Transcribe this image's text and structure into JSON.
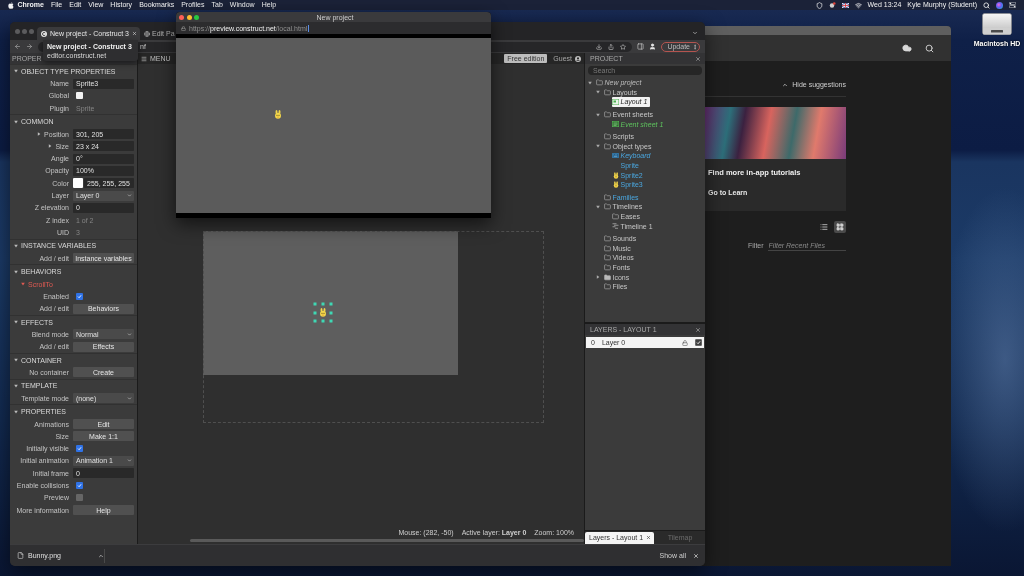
{
  "menu_bar": {
    "app_name": "Chrome",
    "menus": [
      "File",
      "Edit",
      "View",
      "History",
      "Bookmarks",
      "Profiles",
      "Tab",
      "Window",
      "Help"
    ],
    "clock": "Wed 13:24",
    "user": "Kyle Murphy (Student)"
  },
  "desktop_icons": [
    {
      "label": "Macintosh HD"
    }
  ],
  "background_window": {
    "hide_suggestions": "Hide suggestions",
    "tutorial_card": {
      "title": "Find more in-app tutorials",
      "link": "Go to Learn"
    },
    "view_buttons": [
      {
        "kind": "list",
        "selected": false
      },
      {
        "kind": "grid",
        "selected": true
      }
    ],
    "filter": {
      "label": "Filter",
      "placeholder": "Filter Recent Files"
    }
  },
  "browser": {
    "tabs": [
      {
        "title": "New project - Construct 3",
        "selected": true
      },
      {
        "title": "Edit Pa",
        "selected": false
      }
    ],
    "tab_hover_card": {
      "title": "New project - Construct 3",
      "url": "editor.construct.net"
    },
    "address_text": "nf",
    "update_button": "Update",
    "downloads": [
      {
        "name": "Bunny.png"
      }
    ],
    "show_all": "Show all"
  },
  "editor": {
    "properties_panel": {
      "title": "PROPER",
      "sections": [
        {
          "title": "OBJECT TYPE PROPERTIES",
          "expanded": true,
          "rows": [
            {
              "kind": "text",
              "label": "Name",
              "value": "Sprite3"
            },
            {
              "kind": "checkbox",
              "label": "Global",
              "checked": false,
              "disabled": false
            },
            {
              "kind": "info",
              "label": "Plugin",
              "value": "Sprite"
            }
          ]
        },
        {
          "title": "COMMON",
          "expanded": true,
          "rows": [
            {
              "kind": "text",
              "label": "Position",
              "value": "301, 205",
              "expanded": false
            },
            {
              "kind": "text",
              "label": "Size",
              "value": "23 x 24",
              "expanded": false
            },
            {
              "kind": "text",
              "label": "Angle",
              "value": "0°"
            },
            {
              "kind": "text",
              "label": "Opacity",
              "value": "100%"
            },
            {
              "kind": "color",
              "label": "Color",
              "value": "255, 255, 255",
              "color": "#ffffff"
            },
            {
              "kind": "dropdown",
              "label": "Layer",
              "value": "Layer 0"
            },
            {
              "kind": "text",
              "label": "Z elevation",
              "value": "0"
            },
            {
              "kind": "info",
              "label": "Z index",
              "value": "1 of 2"
            },
            {
              "kind": "info",
              "label": "UID",
              "value": "3"
            }
          ]
        },
        {
          "title": "INSTANCE VARIABLES",
          "expanded": true,
          "rows": [
            {
              "kind": "button",
              "label": "Add / edit",
              "value": "Instance variables"
            }
          ]
        },
        {
          "title": "BEHAVIORS",
          "expanded": true,
          "rows": [
            {
              "kind": "behavior",
              "label": "ScrollTo",
              "expanded": true
            },
            {
              "kind": "checkbox",
              "label": "Enabled",
              "checked": true,
              "disabled": false
            },
            {
              "kind": "button",
              "label": "Add / edit",
              "value": "Behaviors"
            }
          ]
        },
        {
          "title": "EFFECTS",
          "expanded": true,
          "rows": [
            {
              "kind": "dropdown",
              "label": "Blend mode",
              "value": "Normal"
            },
            {
              "kind": "button",
              "label": "Add / edit",
              "value": "Effects"
            }
          ]
        },
        {
          "title": "CONTAINER",
          "expanded": true,
          "rows": [
            {
              "kind": "button",
              "label": "No container",
              "value": "Create"
            }
          ]
        },
        {
          "title": "TEMPLATE",
          "expanded": true,
          "rows": [
            {
              "kind": "dropdown",
              "label": "Template mode",
              "value": "(none)"
            }
          ]
        },
        {
          "title": "PROPERTIES",
          "expanded": true,
          "rows": [
            {
              "kind": "button",
              "label": "Animations",
              "value": "Edit"
            },
            {
              "kind": "button",
              "label": "Size",
              "value": "Make 1:1"
            },
            {
              "kind": "checkbox",
              "label": "Initially visible",
              "checked": true,
              "disabled": false
            },
            {
              "kind": "dropdown",
              "label": "Initial animation",
              "value": "Animation 1"
            },
            {
              "kind": "text",
              "label": "Initial frame",
              "value": "0"
            },
            {
              "kind": "checkbox",
              "label": "Enable collisions",
              "checked": true,
              "disabled": false
            },
            {
              "kind": "checkbox",
              "label": "Preview",
              "checked": false,
              "disabled": true
            },
            {
              "kind": "button",
              "label": "More information",
              "value": "Help"
            }
          ]
        }
      ]
    },
    "layout_view": {
      "menu_label": "MENU",
      "edition_badge": "Free edition",
      "user_label": "Guest",
      "sprite_instance": {
        "selected": true
      },
      "status": {
        "mouse": "Mouse: (282, -50)",
        "active_layer": "Active layer: **Layer 0**",
        "zoom": "Zoom: 100%"
      }
    },
    "project_panel": {
      "title": "PROJECT",
      "search_placeholder": "Search",
      "tree": [
        {
          "label": "New project",
          "kind": "root",
          "expanded": true,
          "selected": false,
          "children": [
            {
              "label": "Layouts",
              "kind": "folder",
              "expanded": true,
              "selected": false,
              "children": [
                {
                  "label": "Layout 1",
                  "kind": "layout",
                  "selected": true
                }
              ]
            },
            {
              "label": "Event sheets",
              "kind": "folder",
              "expanded": true,
              "selected": false,
              "children": [
                {
                  "label": "Event sheet 1",
                  "kind": "event-sheet",
                  "selected": false
                }
              ]
            },
            {
              "label": "Scripts",
              "kind": "folder",
              "selected": false
            },
            {
              "label": "Object types",
              "kind": "folder",
              "expanded": true,
              "selected": false,
              "children": [
                {
                  "label": "Keyboard",
                  "kind": "keyboard",
                  "selected": false
                },
                {
                  "label": "Sprite",
                  "kind": "object",
                  "selected": false
                },
                {
                  "label": "Sprite2",
                  "kind": "sprite",
                  "selected": false
                },
                {
                  "label": "Sprite3",
                  "kind": "sprite",
                  "selected": false
                }
              ]
            },
            {
              "label": "Families",
              "kind": "families",
              "selected": false
            },
            {
              "label": "Timelines",
              "kind": "folder",
              "expanded": true,
              "selected": false,
              "children": [
                {
                  "label": "Eases",
                  "kind": "folder",
                  "selected": false
                },
                {
                  "label": "Timeline 1",
                  "kind": "timeline",
                  "selected": false
                }
              ]
            },
            {
              "label": "Sounds",
              "kind": "folder",
              "selected": false
            },
            {
              "label": "Music",
              "kind": "folder",
              "selected": false
            },
            {
              "label": "Videos",
              "kind": "folder",
              "selected": false
            },
            {
              "label": "Fonts",
              "kind": "folder",
              "selected": false
            },
            {
              "label": "Icons",
              "kind": "folder",
              "expanded": false,
              "selected": false
            },
            {
              "label": "Files",
              "kind": "folder",
              "selected": false
            }
          ]
        }
      ]
    },
    "layers_panel": {
      "title": "LAYERS - LAYOUT 1",
      "layers": [
        {
          "index": "0",
          "name": "Layer 0",
          "selected": true,
          "visible": true
        }
      ]
    },
    "bottom_tabs": [
      {
        "label": "Layers - Layout 1",
        "selected": true
      },
      {
        "label": "Tilemap",
        "selected": false
      }
    ]
  },
  "preview_window": {
    "title": "New project",
    "url": {
      "scheme": "https://",
      "host": "preview.construct.net",
      "path": "/local.html"
    }
  }
}
